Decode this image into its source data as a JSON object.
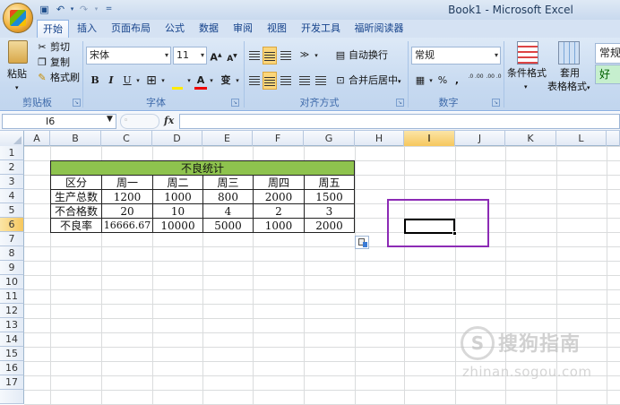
{
  "window": {
    "title": "Book1 - Microsoft Excel"
  },
  "quick_access": {
    "save_icon": "save-icon",
    "undo_icon": "undo-icon",
    "redo_icon": "redo-icon",
    "customize_icon": "customize-icon"
  },
  "tabs": [
    {
      "label": "开始",
      "active": true
    },
    {
      "label": "插入"
    },
    {
      "label": "页面布局"
    },
    {
      "label": "公式"
    },
    {
      "label": "数据"
    },
    {
      "label": "审阅"
    },
    {
      "label": "视图"
    },
    {
      "label": "开发工具"
    },
    {
      "label": "福昕阅读器"
    }
  ],
  "ribbon": {
    "clipboard": {
      "label": "剪贴板",
      "paste": "粘贴",
      "cut": "剪切",
      "copy": "复制",
      "format_painter": "格式刷"
    },
    "font": {
      "label": "字体",
      "font_name": "宋体",
      "font_size": "11",
      "bold": "B",
      "italic": "I",
      "underline": "U",
      "grow": "A",
      "shrink": "A",
      "font_color_glyph": "A",
      "phonetic": "变"
    },
    "alignment": {
      "label": "对齐方式",
      "wrap_text": "自动换行",
      "merge_center": "合并后居中"
    },
    "number": {
      "label": "数字",
      "format": "常规",
      "percent": "%",
      "comma": ",",
      "inc_decimal": ".0 .00",
      "dec_decimal": ".00 .0"
    },
    "styles": {
      "conditional_format": "条件格式",
      "table_format_1": "套用",
      "table_format_2": "表格格式",
      "style_normal": "常规",
      "style_good": "好"
    }
  },
  "formula_bar": {
    "name_box": "I6",
    "fx": "fx",
    "value": ""
  },
  "columns": [
    "A",
    "B",
    "C",
    "D",
    "E",
    "F",
    "G",
    "H",
    "I",
    "J",
    "K",
    "L"
  ],
  "selected_column": "I",
  "rows": [
    "1",
    "2",
    "3",
    "4",
    "5",
    "6",
    "7",
    "8",
    "9",
    "10",
    "11",
    "12",
    "13",
    "14",
    "15",
    "16",
    "17"
  ],
  "selected_row": "6",
  "table": {
    "title": "不良统计",
    "title_fill": "#8ec34e",
    "header": [
      "区分",
      "周一",
      "周二",
      "周三",
      "周四",
      "周五"
    ],
    "body": [
      [
        "生产总数",
        "1200",
        "1000",
        "800",
        "2000",
        "1500"
      ],
      [
        "不合格数",
        "20",
        "10",
        "4",
        "2",
        "3"
      ],
      [
        "不良率",
        "16666.67",
        "10000",
        "5000",
        "1000",
        "2000"
      ]
    ]
  },
  "annotation": {
    "highlight_color": "#8c2bb5"
  },
  "watermark": {
    "logo_glyph": "S",
    "text": "搜狗指南",
    "url": "zhinan.sogou.com"
  }
}
